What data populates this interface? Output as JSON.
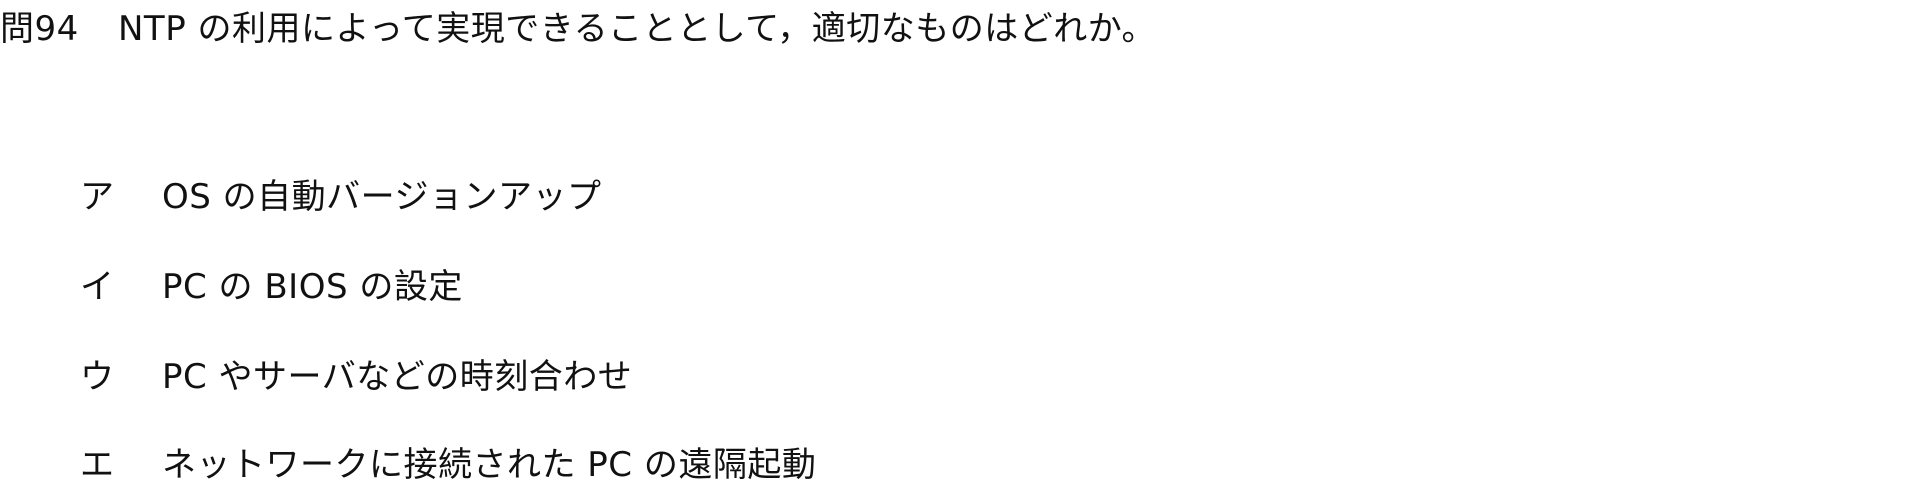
{
  "question": {
    "number": "問94",
    "text": "NTP の利用によって実現できることとして，適切なものはどれか。"
  },
  "choices": [
    {
      "label": "ア",
      "text": "OS の自動バージョンアップ"
    },
    {
      "label": "イ",
      "text": "PC の BIOS の設定"
    },
    {
      "label": "ウ",
      "text": "PC やサーバなどの時刻合わせ"
    },
    {
      "label": "エ",
      "text": "ネットワークに接続された PC の遠隔起動"
    }
  ]
}
